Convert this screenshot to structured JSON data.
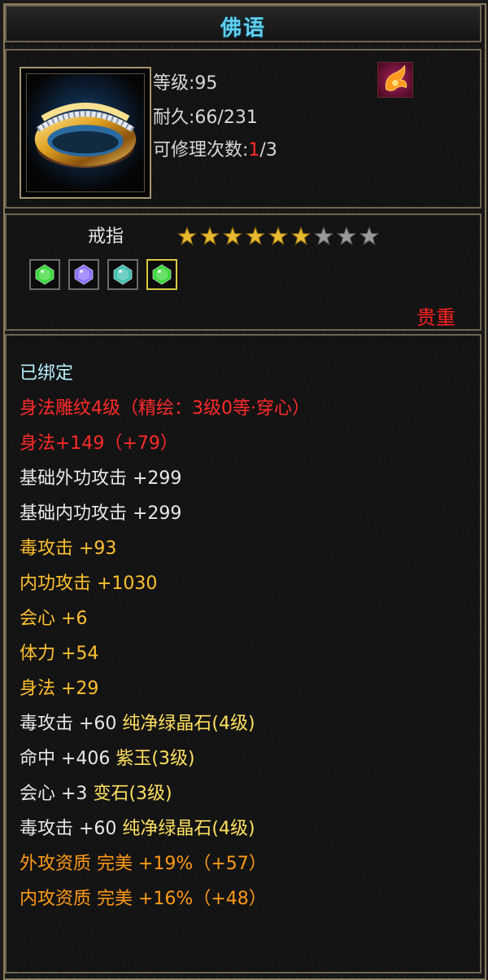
{
  "title": "佛语",
  "item": {
    "level_label": "等级:95",
    "durability_label": "耐久:66/231",
    "repair_prefix": "可修理次数:",
    "repair_used": "1",
    "repair_suffix": "/3",
    "type": "戒指",
    "stars_total": 9,
    "stars_filled": 6,
    "rarity": "贵重",
    "icon": "gold-ring-icon",
    "badge_icon": "dragon-emblem-icon",
    "gems": [
      {
        "icon": "green-crystal-gem-icon",
        "color": "#38d838"
      },
      {
        "icon": "purple-jade-gem-icon",
        "color": "#8a70ff"
      },
      {
        "icon": "change-stone-gem-icon",
        "color": "#40c0b0"
      },
      {
        "icon": "green-crystal-gem-icon",
        "color": "#38d838"
      }
    ]
  },
  "attributes": {
    "bound": "已绑定",
    "engrave": "身法雕纹4级（精绘：3级0等·穿心）",
    "agility_total": "身法+149（+79）",
    "base_ext_attack": "基础外功攻击  +299",
    "base_int_attack": "基础内功攻击  +299",
    "poison_attack": "毒攻击  +93",
    "int_attack": "内功攻击  +1030",
    "crit": "会心  +6",
    "stamina": "体力  +54",
    "agility": "身法  +29",
    "gem1_stat": "毒攻击  +60",
    "gem1_name": "纯净绿晶石(4级)",
    "gem2_stat": "命中  +406",
    "gem2_name": "紫玉(3级)",
    "gem3_stat": "会心  +3",
    "gem3_name": "变石(3级)",
    "gem4_stat": "毒攻击  +60",
    "gem4_name": "纯净绿晶石(4级)",
    "ext_quality": "外攻资质   完美  +19%（+57）",
    "int_quality": "内攻资质   完美  +16%（+48）"
  },
  "colors": {
    "title": "#5fd0f0",
    "red": "#ff2a2a",
    "orange": "#ff9a18",
    "yellow": "#ffc030",
    "cyan": "#b8f0ff"
  }
}
